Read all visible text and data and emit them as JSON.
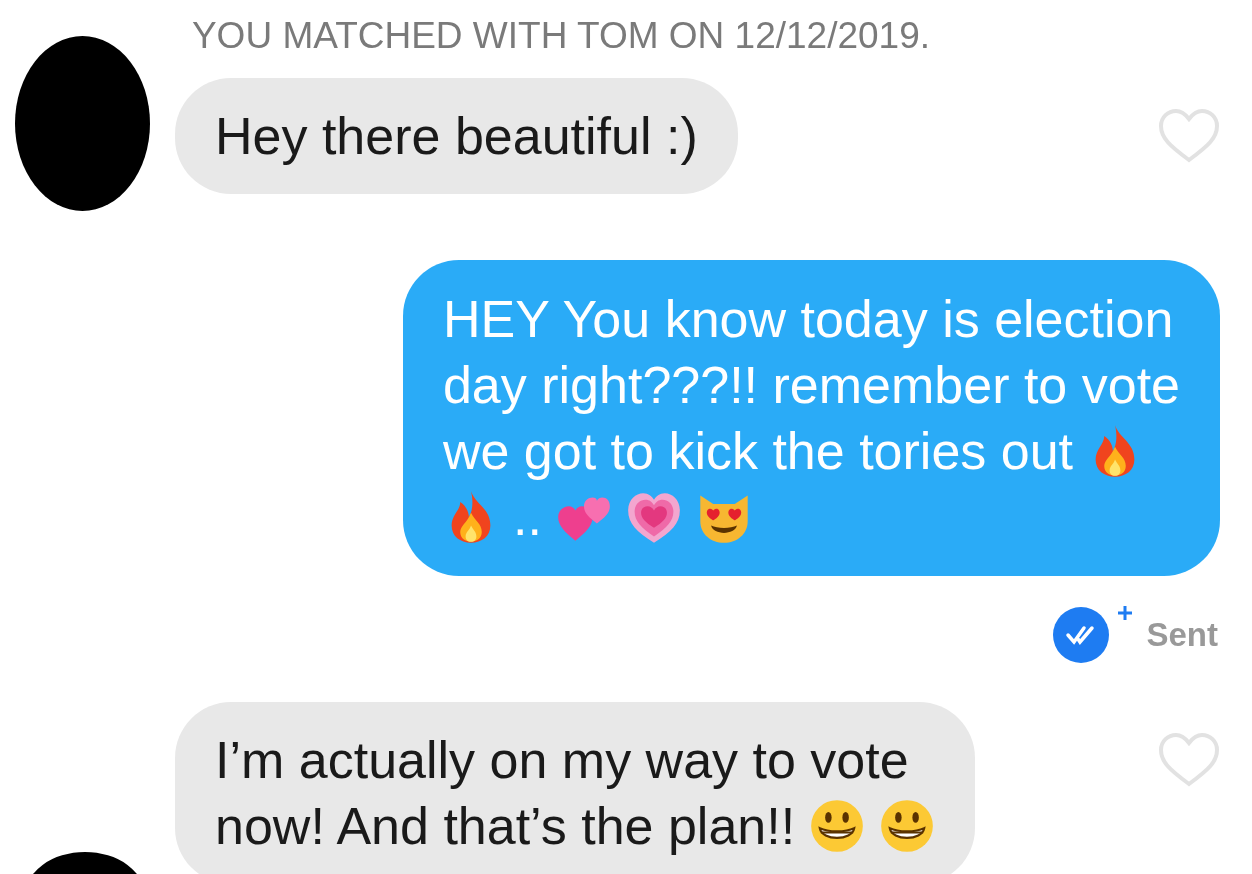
{
  "match_notice": "YOU MATCHED WITH TOM ON 12/12/2019.",
  "messages": [
    {
      "kind": "incoming",
      "liked": false,
      "lines": [
        [
          {
            "kind": "text",
            "text": "Hey there beautiful :)"
          }
        ]
      ]
    },
    {
      "kind": "outgoing",
      "status": "Sent",
      "lines": [
        [
          {
            "kind": "text",
            "text": "HEY You know today is election"
          }
        ],
        [
          {
            "kind": "text",
            "text": "day right???!! remember to vote"
          }
        ],
        [
          {
            "kind": "text",
            "text": "we got to kick the tories out"
          },
          {
            "kind": "fire"
          }
        ],
        [
          {
            "kind": "fire"
          },
          {
            "kind": "text",
            "text": ".."
          },
          {
            "kind": "two-hearts"
          },
          {
            "kind": "growing-heart"
          },
          {
            "kind": "heart-eyes-cat"
          }
        ]
      ]
    },
    {
      "kind": "incoming",
      "liked": false,
      "lines": [
        [
          {
            "kind": "text",
            "text": "I’m actually on my way to vote"
          }
        ],
        [
          {
            "kind": "text",
            "text": "now! And that’s the plan!!"
          },
          {
            "kind": "grin"
          },
          {
            "kind": "grin"
          }
        ]
      ]
    }
  ]
}
